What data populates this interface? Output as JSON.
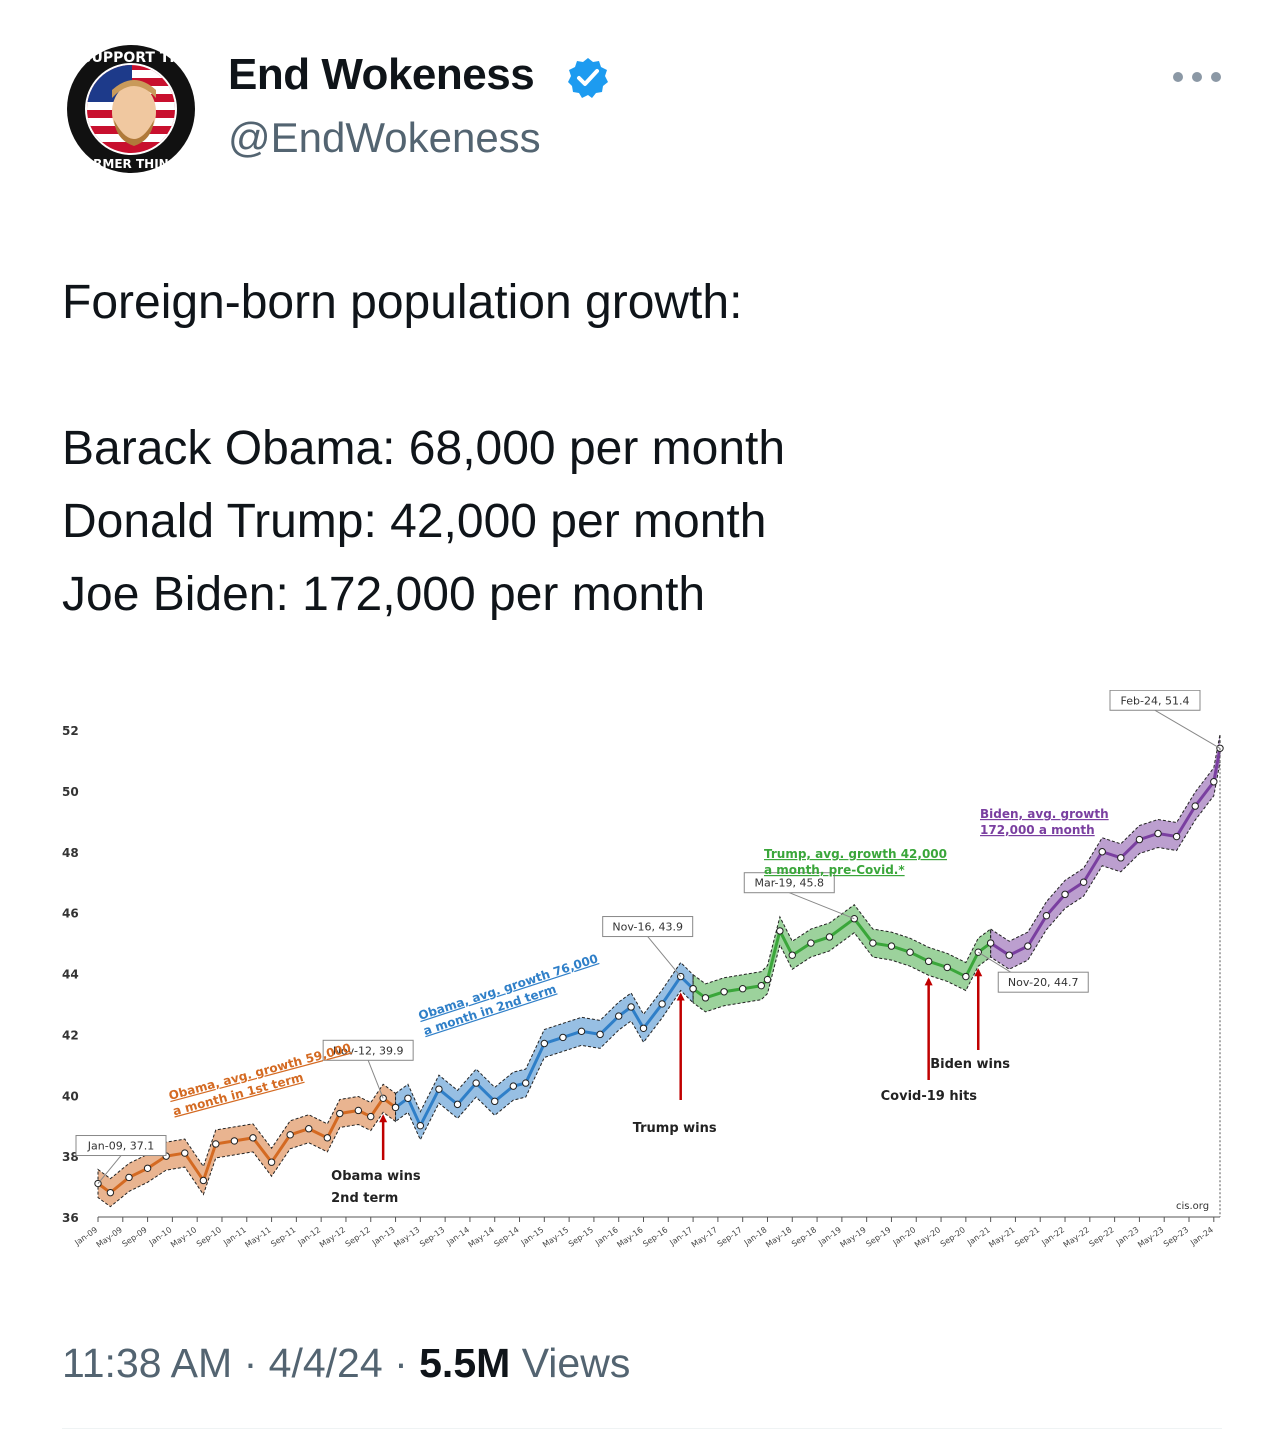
{
  "colors": {
    "obama1": "#d46a22",
    "obama2": "#2f7fc8",
    "trump": "#3aa63a",
    "biden": "#7a3fa0",
    "arrow": "#c00000",
    "muted": "#536471"
  },
  "author": {
    "display_name": "End Wokeness",
    "handle": "@EndWokeness",
    "avatar_badge_top": "I SUPPORT THE",
    "avatar_badge_bottom": "FORMER THINGS",
    "verified_icon": "verified-badge-icon",
    "more_icon": "more-dots-icon"
  },
  "tweet": {
    "line1": "Foreign-born population growth:",
    "line2": "Barack Obama: 68,000 per month",
    "line3": "Donald Trump: 42,000 per month",
    "line4": "Joe Biden: 172,000 per month"
  },
  "meta": {
    "time": "11:38 AM",
    "date": "4/4/24",
    "views": "5.5M",
    "views_label": "Views",
    "sep": "·"
  },
  "chart_data": {
    "type": "line",
    "ylim": [
      36,
      52
    ],
    "yticks": [
      36,
      38,
      40,
      42,
      44,
      46,
      48,
      50,
      52
    ],
    "xticks": [
      "Jan-09",
      "May-09",
      "Sep-09",
      "Jan-10",
      "May-10",
      "Sep-10",
      "Jan-11",
      "May-11",
      "Sep-11",
      "Jan-12",
      "May-12",
      "Sep-12",
      "Jan-13",
      "May-13",
      "Sep-13",
      "Jan-14",
      "May-14",
      "Sep-14",
      "Jan-15",
      "May-15",
      "Sep-15",
      "Jan-16",
      "May-16",
      "Sep-16",
      "Jan-17",
      "May-17",
      "Sep-17",
      "Jan-18",
      "May-18",
      "Sep-18",
      "Jan-19",
      "May-19",
      "Sep-19",
      "Jan-20",
      "May-20",
      "Sep-20",
      "Jan-21",
      "May-21",
      "Sep-21",
      "Jan-22",
      "May-22",
      "Sep-22",
      "Jan-23",
      "May-23",
      "Sep-23",
      "Jan-24"
    ],
    "series": [
      {
        "name": "Obama 1st term",
        "color": "#d46a22",
        "points": [
          [
            "Jan-09",
            37.1
          ],
          [
            "Mar-09",
            36.8
          ],
          [
            "Jun-09",
            37.3
          ],
          [
            "Sep-09",
            37.6
          ],
          [
            "Dec-09",
            38.0
          ],
          [
            "Mar-10",
            38.1
          ],
          [
            "Jun-10",
            37.2
          ],
          [
            "Aug-10",
            38.4
          ],
          [
            "Nov-10",
            38.5
          ],
          [
            "Feb-11",
            38.6
          ],
          [
            "May-11",
            37.8
          ],
          [
            "Aug-11",
            38.7
          ],
          [
            "Nov-11",
            38.9
          ],
          [
            "Feb-12",
            38.6
          ],
          [
            "Apr-12",
            39.4
          ],
          [
            "Jul-12",
            39.5
          ],
          [
            "Sep-12",
            39.3
          ],
          [
            "Nov-12",
            39.9
          ],
          [
            "Jan-13",
            39.6
          ]
        ]
      },
      {
        "name": "Obama 2nd term",
        "color": "#2f7fc8",
        "points": [
          [
            "Jan-13",
            39.6
          ],
          [
            "Mar-13",
            39.9
          ],
          [
            "May-13",
            39.0
          ],
          [
            "Aug-13",
            40.2
          ],
          [
            "Nov-13",
            39.7
          ],
          [
            "Feb-14",
            40.4
          ],
          [
            "May-14",
            39.8
          ],
          [
            "Aug-14",
            40.3
          ],
          [
            "Oct-14",
            40.4
          ],
          [
            "Jan-15",
            41.7
          ],
          [
            "Apr-15",
            41.9
          ],
          [
            "Jul-15",
            42.1
          ],
          [
            "Oct-15",
            42.0
          ],
          [
            "Jan-16",
            42.6
          ],
          [
            "Mar-16",
            42.9
          ],
          [
            "May-16",
            42.2
          ],
          [
            "Aug-16",
            43.0
          ],
          [
            "Nov-16",
            43.9
          ],
          [
            "Jan-17",
            43.5
          ]
        ]
      },
      {
        "name": "Trump",
        "color": "#3aa63a",
        "points": [
          [
            "Jan-17",
            43.5
          ],
          [
            "Mar-17",
            43.2
          ],
          [
            "Jun-17",
            43.4
          ],
          [
            "Sep-17",
            43.5
          ],
          [
            "Dec-17",
            43.6
          ],
          [
            "Jan-18",
            43.8
          ],
          [
            "Mar-18",
            45.4
          ],
          [
            "May-18",
            44.6
          ],
          [
            "Aug-18",
            45.0
          ],
          [
            "Nov-18",
            45.2
          ],
          [
            "Mar-19",
            45.8
          ],
          [
            "Jun-19",
            45.0
          ],
          [
            "Sep-19",
            44.9
          ],
          [
            "Dec-19",
            44.7
          ],
          [
            "Mar-20",
            44.4
          ],
          [
            "Jun-20",
            44.2
          ],
          [
            "Sep-20",
            43.9
          ],
          [
            "Nov-20",
            44.7
          ],
          [
            "Jan-21",
            45.0
          ]
        ]
      },
      {
        "name": "Biden",
        "color": "#7a3fa0",
        "points": [
          [
            "Jan-21",
            45.0
          ],
          [
            "Apr-21",
            44.6
          ],
          [
            "Jul-21",
            44.9
          ],
          [
            "Oct-21",
            45.9
          ],
          [
            "Jan-22",
            46.6
          ],
          [
            "Apr-22",
            47.0
          ],
          [
            "Jul-22",
            48.0
          ],
          [
            "Oct-22",
            47.8
          ],
          [
            "Jan-23",
            48.4
          ],
          [
            "Apr-23",
            48.6
          ],
          [
            "Jul-23",
            48.5
          ],
          [
            "Oct-23",
            49.5
          ],
          [
            "Jan-24",
            50.3
          ],
          [
            "Feb-24",
            51.4
          ]
        ]
      }
    ],
    "callouts": [
      {
        "text": "Jan-09, 37.1",
        "date": "Jan-09",
        "value": 37.1
      },
      {
        "text": "Nov-12, 39.9",
        "date": "Nov-12",
        "value": 39.9
      },
      {
        "text": "Nov-16, 43.9",
        "date": "Nov-16",
        "value": 43.9
      },
      {
        "text": "Mar-19, 45.8",
        "date": "Mar-19",
        "value": 45.8
      },
      {
        "text": "Nov-20, 44.7",
        "date": "Nov-20",
        "value": 44.7
      },
      {
        "text": "Feb-24, 51.4",
        "date": "Feb-24",
        "value": 51.4
      }
    ],
    "annotations": [
      {
        "text": "Obama, avg. growth 59,000",
        "line2": "a month in 1st term",
        "color": "#d46a22"
      },
      {
        "text": "Obama, avg. growth 76,000",
        "line2": "a month in 2nd term",
        "color": "#2f7fc8"
      },
      {
        "text": "Trump, avg. growth 42,000",
        "line2": "a month, pre-Covid.*",
        "color": "#3aa63a"
      },
      {
        "text": "Biden, avg. growth",
        "line2": "172,000 a month",
        "color": "#7a3fa0"
      }
    ],
    "events": [
      {
        "text": "Obama wins",
        "line2": "2nd term",
        "date": "Nov-12"
      },
      {
        "text": "Trump wins",
        "line2": "",
        "date": "Nov-16"
      },
      {
        "text": "Covid-19 hits",
        "line2": "",
        "date": "Mar-20"
      },
      {
        "text": "Biden wins",
        "line2": "",
        "date": "Nov-20"
      }
    ],
    "source": "cis.org"
  }
}
